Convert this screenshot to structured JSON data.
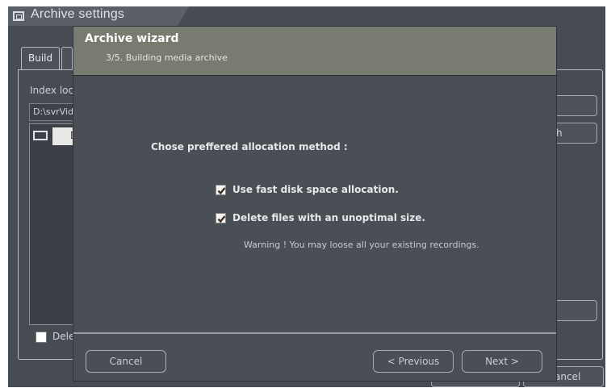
{
  "background_window": {
    "title": "Archive settings",
    "tabs": [
      {
        "label": "Build"
      },
      {
        "label": ""
      }
    ],
    "index_label": "Index loc",
    "index_path": "D:\\svrVid",
    "list_selected_label": "D",
    "right_button_1": "",
    "right_button_2": "h",
    "right_button_3": "",
    "delete_label": "Dele",
    "ok_button": "",
    "cancel_button": "ancel"
  },
  "wizard": {
    "title": "Archive wizard",
    "step": "3/5. Building media archive",
    "prompt": "Chose preffered allocation method :",
    "options": [
      {
        "label": "Use fast disk space allocation.",
        "checked": true
      },
      {
        "label": "Delete files with an unoptimal size.",
        "checked": true
      }
    ],
    "warning": "Warning ! You may loose all your existing recordings.",
    "buttons": {
      "cancel": "Cancel",
      "previous": "< Previous",
      "next": "Next >"
    }
  }
}
